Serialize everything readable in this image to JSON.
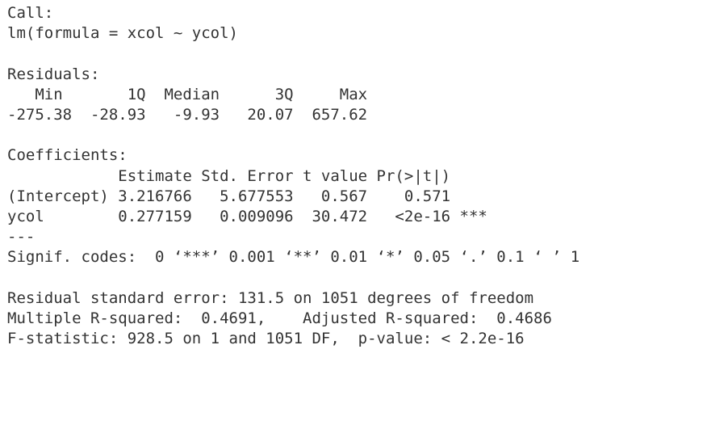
{
  "call": {
    "header": "Call:",
    "formula": "lm(formula = xcol ~ ycol)"
  },
  "residuals": {
    "header": "Residuals:",
    "labels_line": "   Min       1Q  Median      3Q     Max ",
    "values_line": "-275.38  -28.93   -9.93   20.07  657.62 ",
    "labels": [
      "Min",
      "1Q",
      "Median",
      "3Q",
      "Max"
    ],
    "values": [
      "-275.38",
      "-28.93",
      "-9.93",
      "20.07",
      "657.62"
    ]
  },
  "coefficients": {
    "header": "Coefficients:",
    "columns_line": "            Estimate Std. Error t value Pr(>|t|)    ",
    "rows": [
      {
        "line": "(Intercept) 3.216766   5.677553   0.567    0.571    ",
        "term": "(Intercept)",
        "estimate": "3.216766",
        "std_error": "5.677553",
        "t_value": "0.567",
        "p_value": "0.571",
        "signif": ""
      },
      {
        "line": "ycol        0.277159   0.009096  30.472   <2e-16 ***",
        "term": "ycol",
        "estimate": "0.277159",
        "std_error": "0.009096",
        "t_value": "30.472",
        "p_value": "<2e-16",
        "signif": "***"
      }
    ],
    "separator": "---",
    "signif_codes": "Signif. codes:  0 ‘***’ 0.001 ‘**’ 0.01 ‘*’ 0.05 ‘.’ 0.1 ‘ ’ 1"
  },
  "summary": {
    "residual_se": "Residual standard error: 131.5 on 1051 degrees of freedom",
    "r_squared": "Multiple R-squared:  0.4691,\tAdjusted R-squared:  0.4686 ",
    "f_statistic": "F-statistic: 928.5 on 1 and 1051 DF,  p-value: < 2.2e-16"
  }
}
